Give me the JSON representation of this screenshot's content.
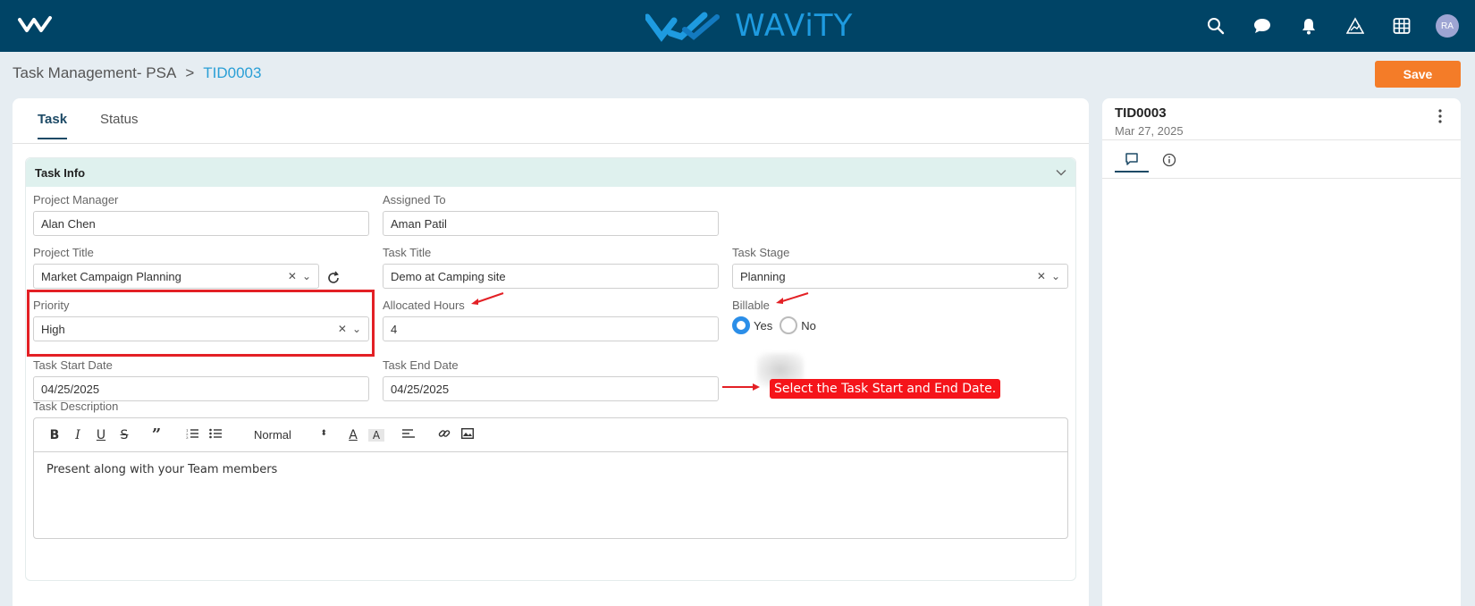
{
  "header": {
    "brand_name": "WAViTY",
    "avatar_initials": "RA",
    "brand_color": "#1e9be0",
    "bar_color": "#004466"
  },
  "breadcrumb": {
    "parent": "Task Management- PSA",
    "separator": ">",
    "current": "TID0003"
  },
  "toolbar": {
    "save_label": "Save"
  },
  "tabs": [
    {
      "label": "Task",
      "active": true
    },
    {
      "label": "Status",
      "active": false
    }
  ],
  "section": {
    "title": "Task Info"
  },
  "fields": {
    "project_manager": {
      "label": "Project Manager",
      "value": "Alan Chen"
    },
    "assigned_to": {
      "label": "Assigned To",
      "value": "Aman Patil"
    },
    "project_title": {
      "label": "Project Title",
      "value": "Market Campaign Planning"
    },
    "task_title": {
      "label": "Task Title",
      "value": "Demo at Camping site"
    },
    "task_stage": {
      "label": "Task Stage",
      "value": "Planning"
    },
    "priority": {
      "label": "Priority",
      "value": "High"
    },
    "allocated_hours": {
      "label": "Allocated Hours",
      "value": "4"
    },
    "billable": {
      "label": "Billable",
      "yes": "Yes",
      "no": "No",
      "selected": "Yes"
    },
    "start_date": {
      "label": "Task Start Date",
      "value": "04/25/2025"
    },
    "end_date": {
      "label": "Task End Date",
      "value": "04/25/2025"
    },
    "description": {
      "label": "Task Description",
      "format": "Normal",
      "text": "Present along with your Team members"
    }
  },
  "annotation": {
    "text": "Select the Task Start and End Date."
  },
  "side_panel": {
    "title": "TID0003",
    "date": "Mar 27, 2025"
  }
}
